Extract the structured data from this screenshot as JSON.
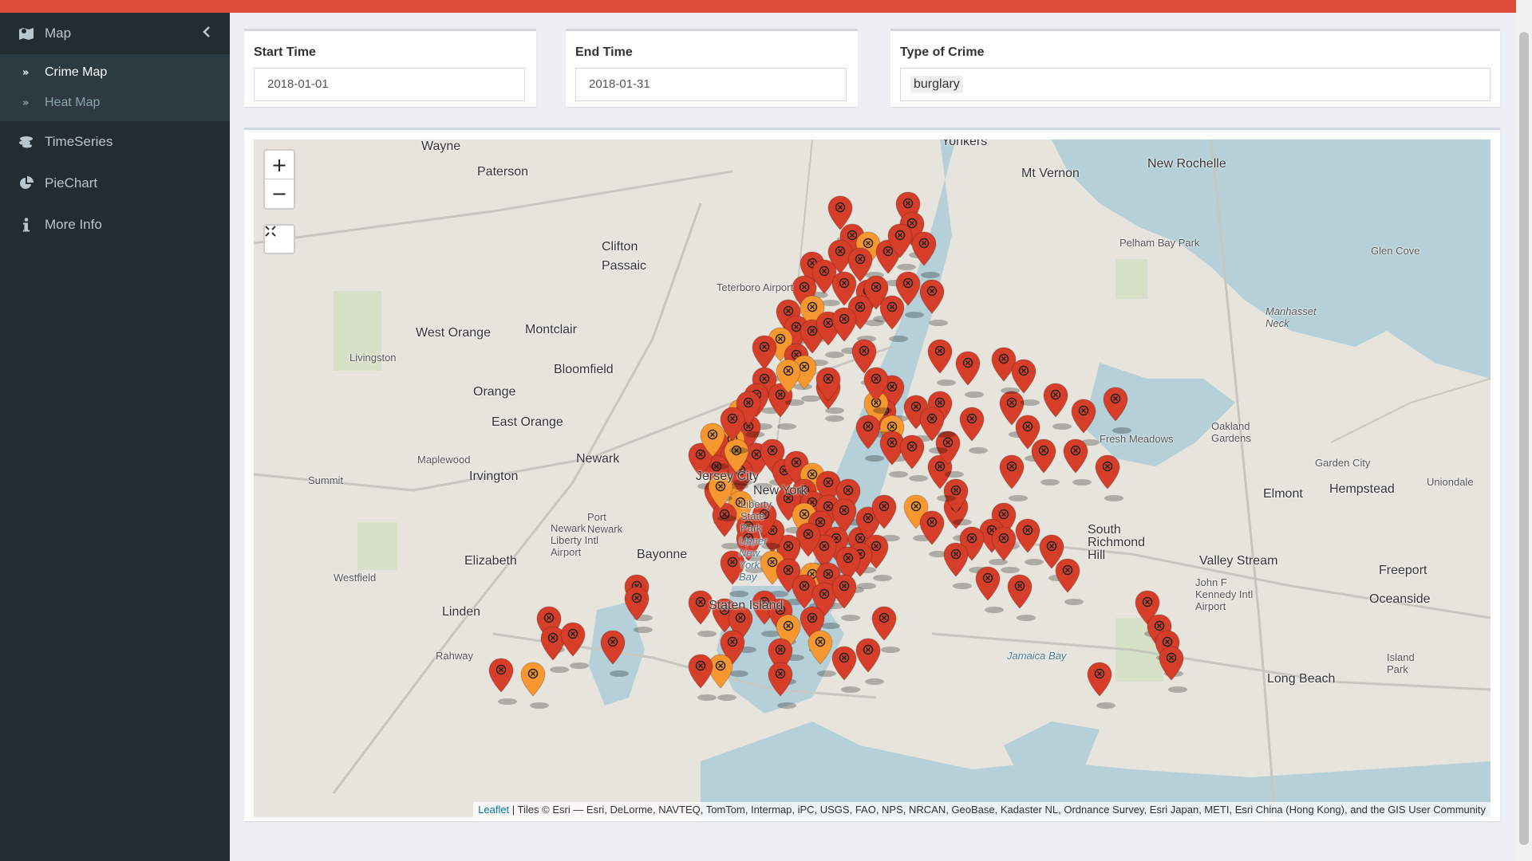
{
  "sidebar": {
    "items": [
      {
        "label": "Map",
        "icon": "map-icon"
      },
      {
        "label": "TimeSeries",
        "icon": "timeseries-icon"
      },
      {
        "label": "PieChart",
        "icon": "piechart-icon"
      },
      {
        "label": "More Info",
        "icon": "info-icon"
      }
    ],
    "map_submenu": [
      {
        "label": "Crime Map",
        "active": true
      },
      {
        "label": "Heat Map",
        "active": false
      }
    ]
  },
  "filters": {
    "start_time": {
      "label": "Start Time",
      "value": "2018-01-01"
    },
    "end_time": {
      "label": "End Time",
      "value": "2018-01-31"
    },
    "crime_type": {
      "label": "Type of Crime",
      "value": "burglary"
    }
  },
  "map": {
    "zoom_in": "+",
    "zoom_out": "−",
    "attribution_link": "Leaflet",
    "attribution_text": " | Tiles © Esri — Esri, DeLorme, NAVTEQ, TomTom, Intermap, iPC, USGS, FAO, NPS, NRCAN, GeoBase, Kadaster NL, Ordnance Survey, Esri Japan, METI, Esri China (Hong Kong), and the GIS User Community",
    "places": [
      "Wayne",
      "Paterson",
      "Yonkers",
      "Mt Vernon",
      "New Rochelle",
      "Clifton",
      "Passaic",
      "Teterboro Airport",
      "Pelham Bay Park",
      "Glen Cove",
      "West Orange",
      "Montclair",
      "Livingston",
      "Bloomfield",
      "Orange",
      "East Orange",
      "Maplewood",
      "Newark",
      "Irvington",
      "Summit",
      "Jersey City",
      "New York",
      "Elizabeth",
      "Bayonne",
      "Linden",
      "Staten Island",
      "Rahway",
      "Westfield",
      "Garden City",
      "Hempstead",
      "Uniondale",
      "Elmont",
      "South Richmond Hill",
      "Valley Stream",
      "Freeport",
      "Oceanside",
      "Long Beach",
      "Island Park",
      "Jamaica Bay",
      "Fresh Meadows",
      "Oakland Gardens",
      "Manhasset Neck",
      "Port Newark",
      "Upper New York Bay",
      "Liberty State Park",
      "Newark Liberty Intl Airport",
      "John F Kennedy Intl Airport"
    ],
    "marker_colors": {
      "red": "#d63e2a",
      "orange": "#f69730"
    }
  }
}
